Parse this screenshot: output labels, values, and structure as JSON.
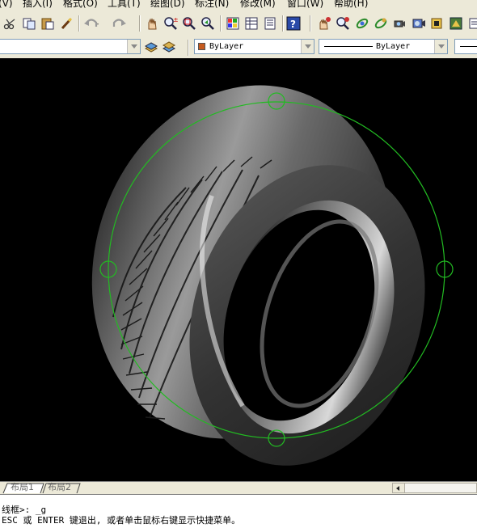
{
  "menu": {
    "items": [
      "(V)",
      "插入(I)",
      "格式(O)",
      "工具(T)",
      "绘图(D)",
      "标注(N)",
      "修改(M)",
      "窗口(W)",
      "帮助(H)"
    ]
  },
  "toolbar": {
    "icons": [
      "cut-icon",
      "copy-icon",
      "paste-icon",
      "match-properties-icon",
      "undo-icon",
      "redo-icon",
      "pan-icon",
      "zoom-realtime-icon",
      "zoom-window-icon",
      "zoom-previous-icon",
      "properties-icon",
      "design-center-icon",
      "tool-palettes-icon",
      "help-icon",
      "pan-3d-icon",
      "zoom-3d-icon",
      "orbit-icon",
      "continuous-orbit-icon",
      "swivel-icon",
      "walk-icon",
      "camera-icon",
      "render-icon"
    ]
  },
  "properties_bar": {
    "layer_value": "",
    "color_value": "ByLayer",
    "color_swatch": "#c65a1e",
    "linetype_value": "ByLayer"
  },
  "drawing": {
    "background": "#000000",
    "orbit_color": "#22bb22",
    "object": "tire"
  },
  "layout_tabs": [
    "布局1",
    "布局2"
  ],
  "command_line": {
    "line1": "线框>: _g",
    "line2": "ESC 或 ENTER 键退出, 或者单击鼠标右键显示快捷菜单。"
  }
}
